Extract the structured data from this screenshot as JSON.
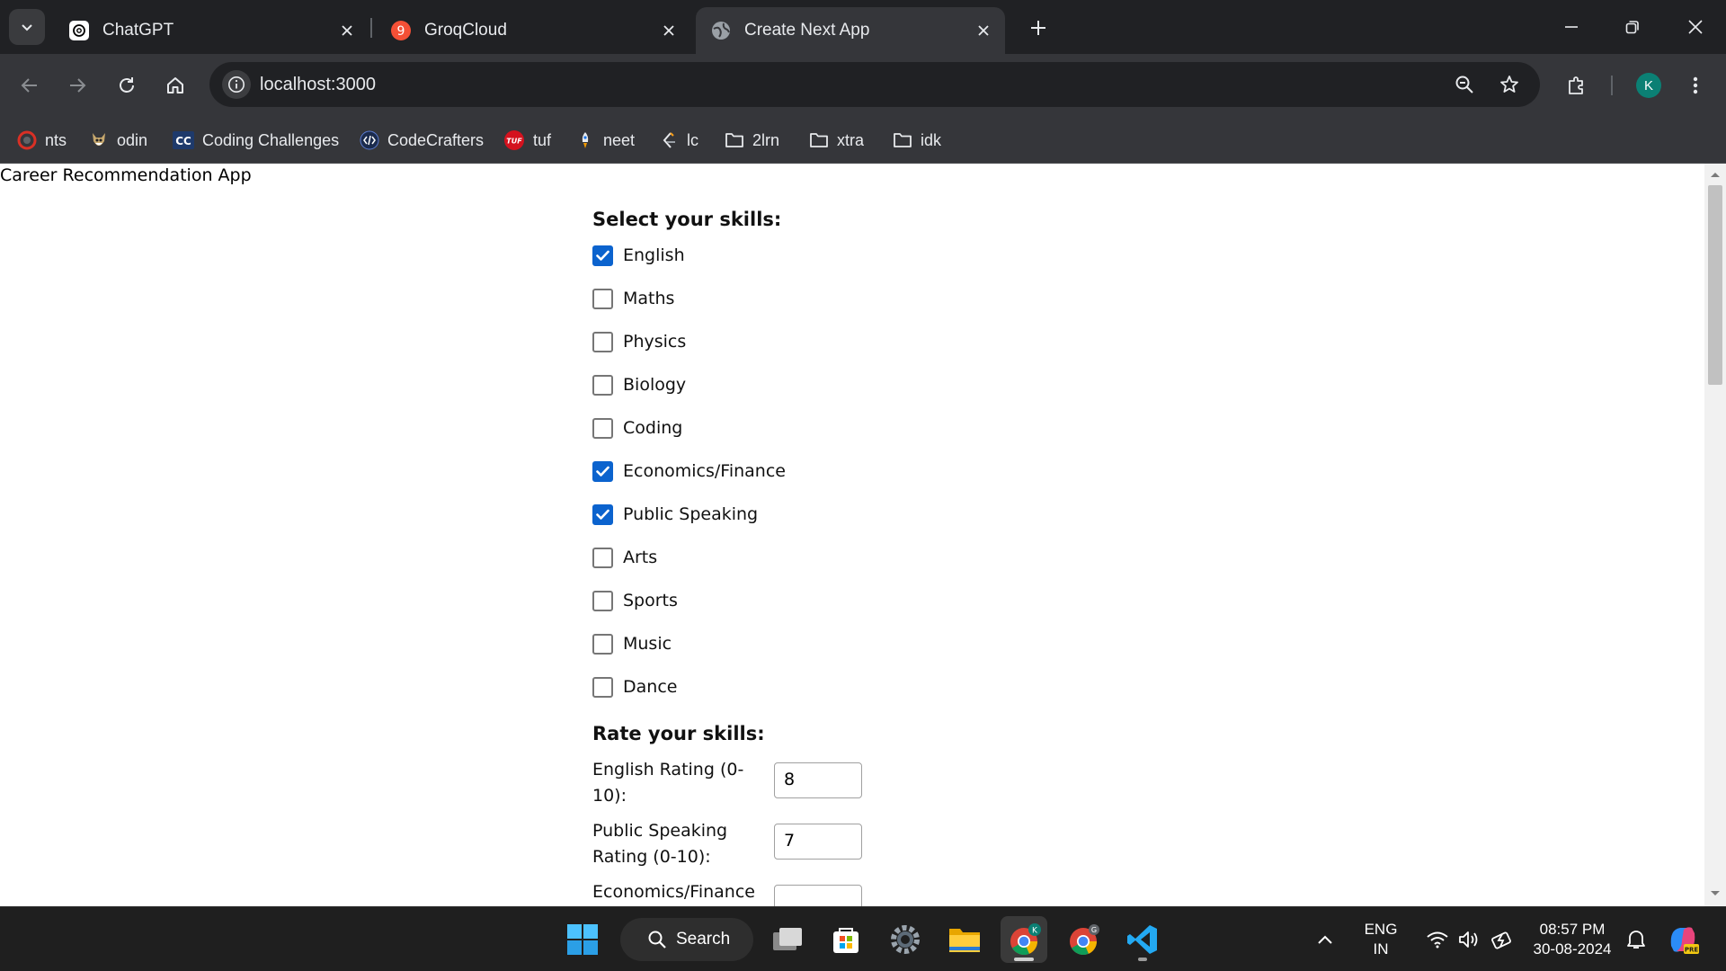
{
  "browser": {
    "tabs": [
      {
        "title": "ChatGPT",
        "favicon": "chatgpt-icon",
        "active": false
      },
      {
        "title": "GroqCloud",
        "favicon": "groqcloud-icon",
        "active": false
      },
      {
        "title": "Create Next App",
        "favicon": "globe-icon",
        "active": true
      }
    ],
    "url": "localhost:3000",
    "profile_initial": "K",
    "bookmarks": [
      {
        "label": "nts",
        "icon": "nts-icon"
      },
      {
        "label": "odin",
        "icon": "odin-icon"
      },
      {
        "label": "Coding Challenges",
        "icon": "cc-icon",
        "icon_text": "CC"
      },
      {
        "label": "CodeCrafters",
        "icon": "codecrafters-icon"
      },
      {
        "label": "tuf",
        "icon": "tuf-icon",
        "icon_text": "TUF"
      },
      {
        "label": "neet",
        "icon": "neet-icon"
      },
      {
        "label": "lc",
        "icon": "leetcode-icon"
      },
      {
        "label": "2lrn",
        "icon": "folder-icon"
      },
      {
        "label": "xtra",
        "icon": "folder-icon"
      },
      {
        "label": "idk",
        "icon": "folder-icon"
      }
    ]
  },
  "page": {
    "app_title": "Career Recommendation App",
    "skills_heading": "Select your skills:",
    "skills": [
      {
        "label": "English",
        "checked": true
      },
      {
        "label": "Maths",
        "checked": false
      },
      {
        "label": "Physics",
        "checked": false
      },
      {
        "label": "Biology",
        "checked": false
      },
      {
        "label": "Coding",
        "checked": false
      },
      {
        "label": "Economics/Finance",
        "checked": true
      },
      {
        "label": "Public Speaking",
        "checked": true
      },
      {
        "label": "Arts",
        "checked": false
      },
      {
        "label": "Sports",
        "checked": false
      },
      {
        "label": "Music",
        "checked": false
      },
      {
        "label": "Dance",
        "checked": false
      }
    ],
    "ratings_heading": "Rate your skills:",
    "ratings": [
      {
        "label": "English Rating (0-10):",
        "value": "8"
      },
      {
        "label": "Public Speaking Rating (0-10):",
        "value": "7"
      },
      {
        "label": "Economics/Finance",
        "value": ""
      }
    ]
  },
  "taskbar": {
    "search_label": "Search",
    "language": "ENG",
    "region": "IN",
    "time": "08:57 PM",
    "date": "30-08-2024"
  },
  "colors": {
    "checkbox_accent": "#0b63ce",
    "profile_badge": "#0b8074",
    "tab_strip": "#202124",
    "toolbar": "#35363a"
  }
}
